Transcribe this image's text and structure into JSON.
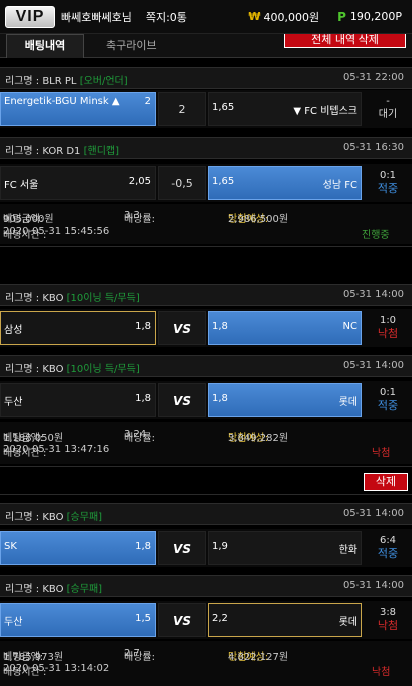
{
  "header": {
    "logo": "VIP",
    "nickname": "빠쎄호빠쎄호님",
    "notes": "쪽지:0통",
    "money_symbol": "₩",
    "money": "400,000원",
    "point_symbol": "P",
    "point": "190,200P"
  },
  "tabs": {
    "active": "배팅내역",
    "live": "축구라이브",
    "delete_all": "전체 내역 삭제"
  },
  "slips": [
    {
      "league": "리그명 : BLR PL",
      "tag": "[오버/언더]",
      "time": "05-31 22:00",
      "home": "Energetik-BGU Minsk ▲",
      "home_odds": "2",
      "mid": "2",
      "away": "▼ FC 비텝스크",
      "away_odds": "1,65",
      "score": "-",
      "status": "대기"
    },
    {
      "league": "리그명 : KOR D1",
      "tag": "[핸디캡]",
      "time": "05-31 16:30",
      "home": "FC 서울",
      "home_odds": "2,05",
      "mid": "-0,5",
      "away": "성남 FC",
      "away_odds": "1,65",
      "score": "0:1",
      "status": "적중",
      "bet_amount_label": "베팅금액: ",
      "bet_amount": "905,000원",
      "bet_odds_label": "배당률: ",
      "bet_odds": "3,3",
      "expected_label": "당첨예상: ",
      "expected": "2,986,500원",
      "time_label": "배팅시간 : ",
      "bet_time": "2020-05-31 15:45:56",
      "result": "진행중"
    },
    {
      "league": "리그명 : KBO",
      "tag": "[10이닝 득/무득]",
      "time": "05-31 14:00",
      "home": "삼성",
      "home_odds": "1,8",
      "mid": "VS",
      "away": "NC",
      "away_odds": "1,8",
      "score": "1:0",
      "status": "낙첨"
    },
    {
      "league": "리그명 : KBO",
      "tag": "[10이닝 득/무득]",
      "time": "05-31 14:00",
      "home": "두산",
      "home_odds": "1,8",
      "mid": "VS",
      "away": "롯데",
      "away_odds": "1,8",
      "score": "0:1",
      "status": "적중",
      "bet_amount_label": "베팅금액: ",
      "bet_amount": "1,188,050원",
      "bet_odds_label": "배당률: ",
      "bet_odds": "3,24",
      "expected_label": "당첨예상: ",
      "expected": "3,849,282원",
      "time_label": "배팅시간 : ",
      "bet_time": "2020-05-31 13:47:16",
      "result": "낙첨"
    },
    {
      "league": "리그명 : KBO",
      "tag": "[승무패]",
      "time": "05-31 14:00",
      "home": "SK",
      "home_odds": "1,8",
      "mid": "VS",
      "away": "한화",
      "away_odds": "1,9",
      "score": "6:4",
      "status": "적중"
    },
    {
      "league": "리그명 : KBO",
      "tag": "[승무패]",
      "time": "05-31 14:00",
      "home": "두산",
      "home_odds": "1,5",
      "mid": "VS",
      "away": "롯데",
      "away_odds": "2,2",
      "score": "3:8",
      "status": "낙첨",
      "bet_amount_label": "베팅금액: ",
      "bet_amount": "1,785,973원",
      "bet_odds_label": "배당률: ",
      "bet_odds": "2,7",
      "expected_label": "당첨예상: ",
      "expected": "4,822,127원",
      "time_label": "배팅시간 : ",
      "bet_time": "2020-05-31 13:14:02",
      "result": "낙첨"
    }
  ],
  "delete_label": "삭제"
}
